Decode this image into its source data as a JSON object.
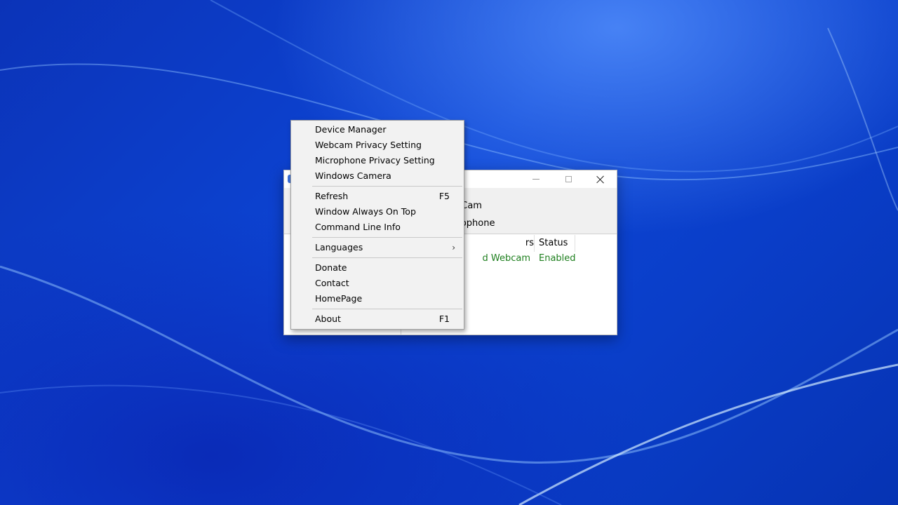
{
  "app_window": {
    "toolbar": {
      "webcam_label": "ebCam",
      "microphone_label": "icrophone"
    },
    "list": {
      "columns": [
        "rs",
        "Status"
      ],
      "rows": [
        {
          "device": "d Webcam",
          "status": "Enabled"
        }
      ]
    },
    "colors": {
      "enabled_text": "#1e7f1e"
    }
  },
  "context_menu": {
    "items": [
      {
        "label": "Device Manager"
      },
      {
        "label": "Webcam Privacy Setting"
      },
      {
        "label": "Microphone Privacy Setting"
      },
      {
        "label": "Windows Camera"
      },
      {
        "label": "Refresh",
        "shortcut": "F5"
      },
      {
        "label": "Window Always On Top"
      },
      {
        "label": "Command Line Info"
      },
      {
        "label": "Languages",
        "submenu_arrow": "›"
      },
      {
        "label": "Donate"
      },
      {
        "label": "Contact"
      },
      {
        "label": "HomePage"
      },
      {
        "label": "About",
        "shortcut": "F1"
      }
    ]
  },
  "icons": {
    "minimize": "minimize-icon",
    "maximize": "maximize-icon",
    "close": "close-icon",
    "submenu": "chevron-right-icon"
  }
}
